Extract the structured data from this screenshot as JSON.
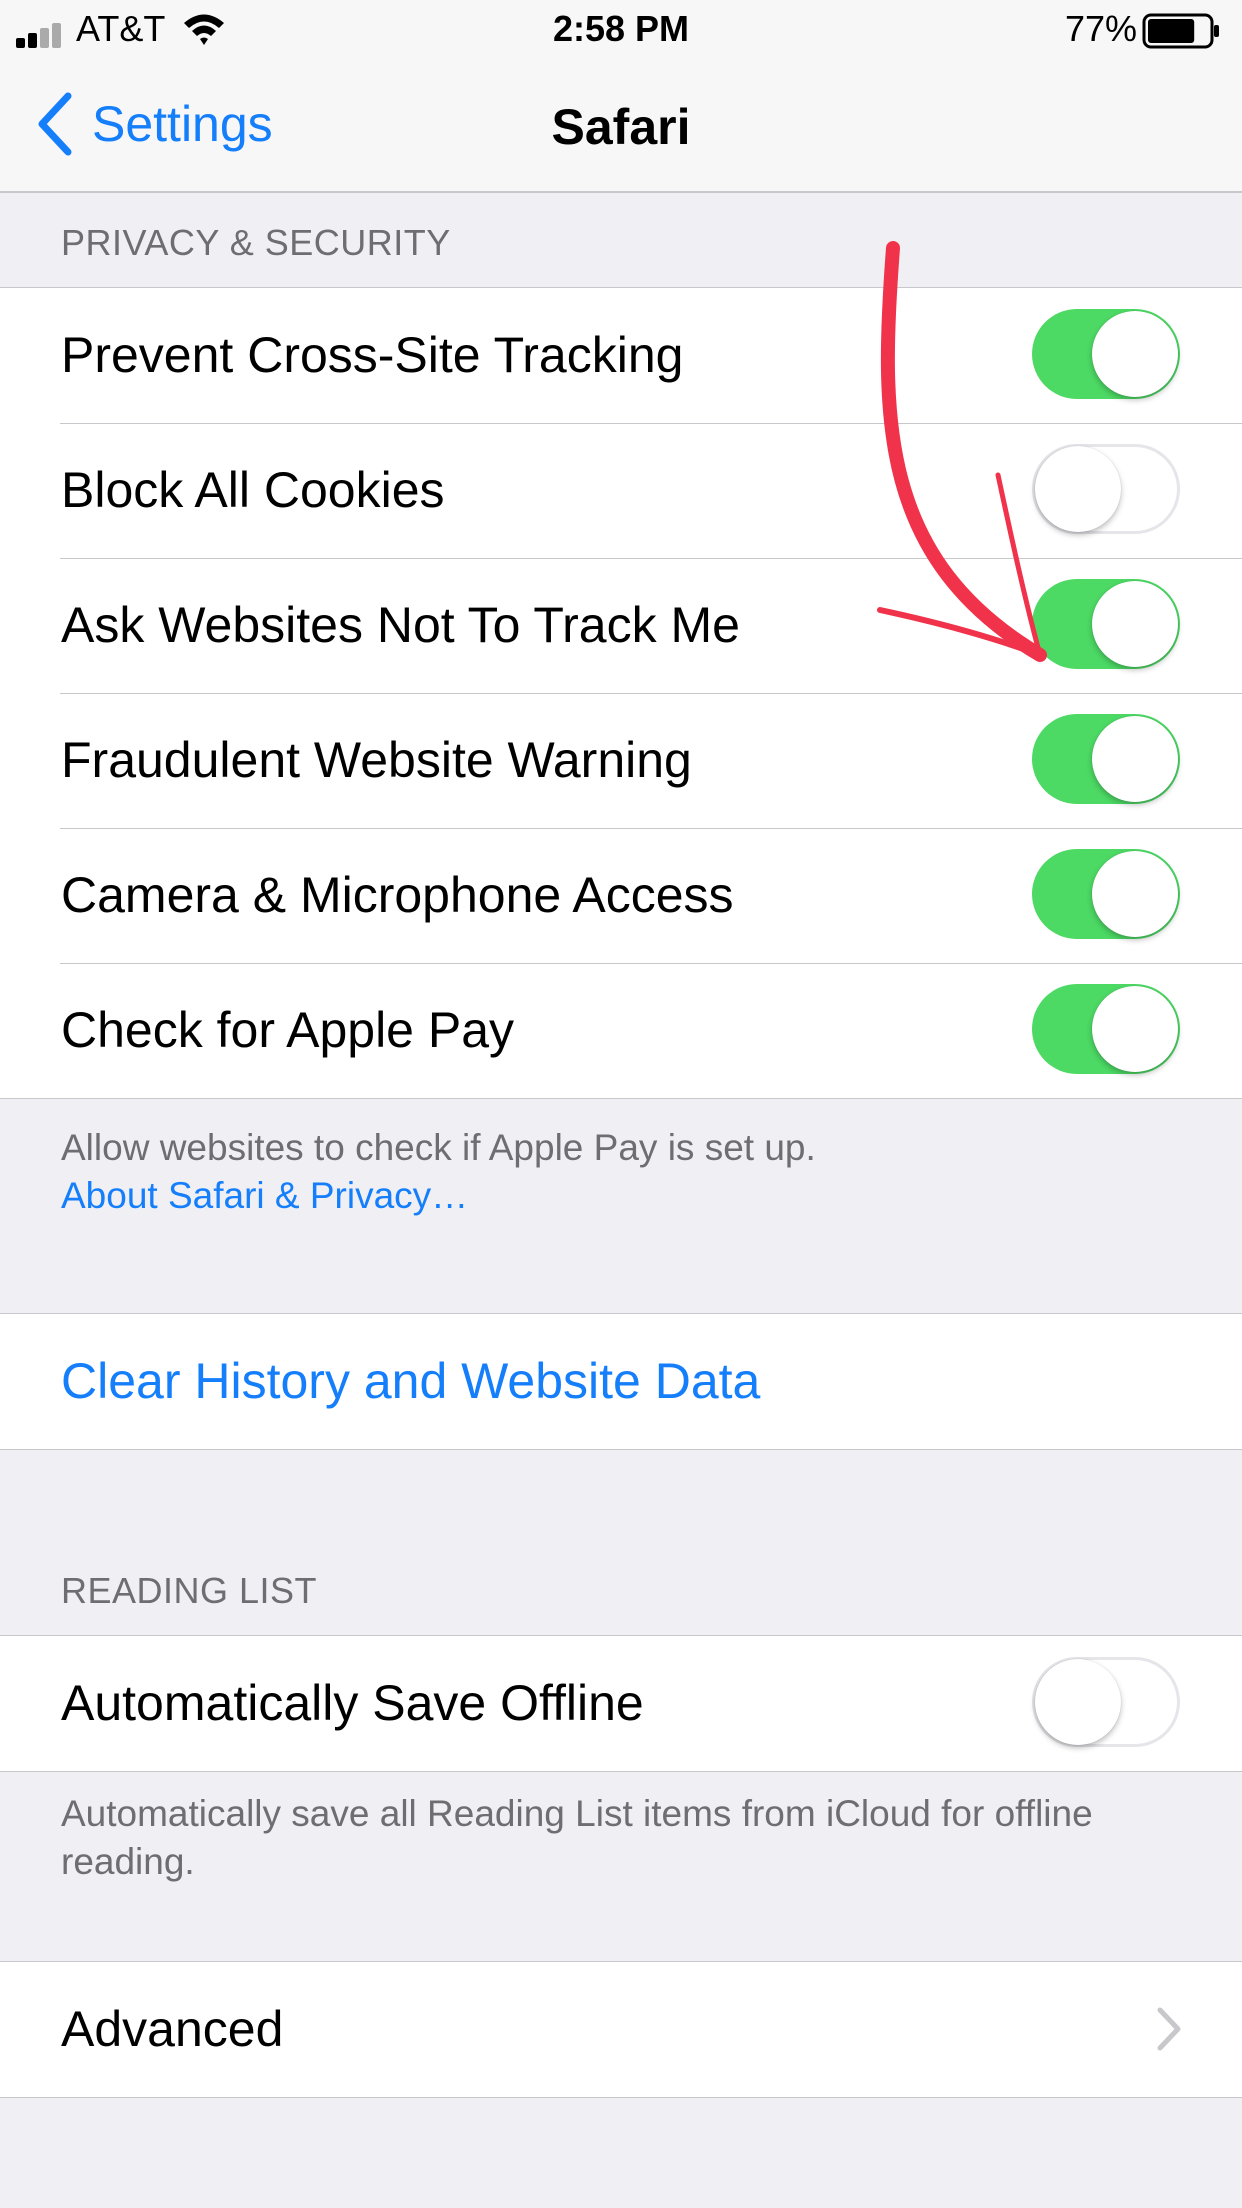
{
  "status_bar": {
    "carrier": "AT&T",
    "time": "2:58 PM",
    "battery_percent": "77%",
    "battery_level": 0.77
  },
  "nav": {
    "back_label": "Settings",
    "title": "Safari"
  },
  "privacy_section": {
    "header": "PRIVACY & SECURITY",
    "rows": [
      {
        "label": "Prevent Cross-Site Tracking",
        "on": true
      },
      {
        "label": "Block All Cookies",
        "on": false
      },
      {
        "label": "Ask Websites Not To Track Me",
        "on": true
      },
      {
        "label": "Fraudulent Website Warning",
        "on": true
      },
      {
        "label": "Camera & Microphone Access",
        "on": true
      },
      {
        "label": "Check for Apple Pay",
        "on": true
      }
    ],
    "footer_text": "Allow websites to check if Apple Pay is set up.",
    "footer_link": "About Safari & Privacy…"
  },
  "clear_history": {
    "label": "Clear History and Website Data"
  },
  "reading_list": {
    "header": "READING LIST",
    "row": {
      "label": "Automatically Save Offline",
      "on": false
    },
    "footer_text": "Automatically save all Reading List items from iCloud for offline reading."
  },
  "advanced": {
    "label": "Advanced"
  },
  "colors": {
    "accent": "#147efb",
    "toggle_on": "#4cd964",
    "annotation": "#f0334a",
    "background": "#efeff4"
  }
}
